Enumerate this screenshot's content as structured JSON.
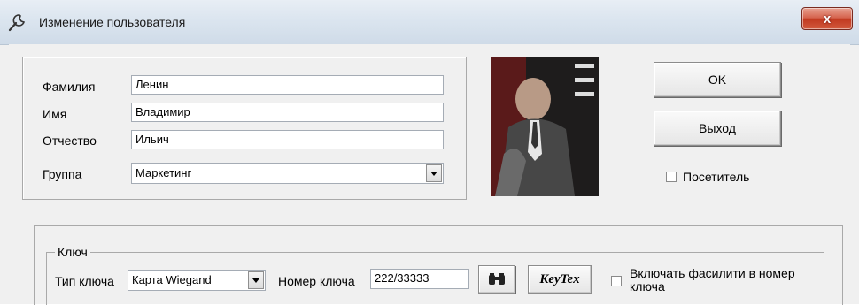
{
  "window": {
    "title": "Изменение пользователя",
    "close_label": "x",
    "title_icon": "wrench-icon"
  },
  "person": {
    "last_name_label": "Фамилия",
    "last_name_value": "Ленин",
    "first_name_label": "Имя",
    "first_name_value": "Владимир",
    "patronymic_label": "Отчество",
    "patronymic_value": "Ильич",
    "group_label": "Группа",
    "group_value": "Маркетинг"
  },
  "actions": {
    "ok_label": "OK",
    "exit_label": "Выход",
    "visitor_label": "Посетитель",
    "visitor_checked": false
  },
  "key": {
    "group_title": "Ключ",
    "type_label": "Тип ключа",
    "type_value": "Карта Wiegand",
    "number_label": "Номер ключа",
    "number_value": "222/33333",
    "search_icon": "binoculars-icon",
    "keytex_label": "KeyTex",
    "facility_label_line1": "Включать фасилити в номер",
    "facility_label_line2": "ключа",
    "facility_checked": false
  },
  "colors": {
    "window_bg": "#f0f0f0",
    "titlebar": "#dbe5ef",
    "close_red": "#c23b22"
  }
}
